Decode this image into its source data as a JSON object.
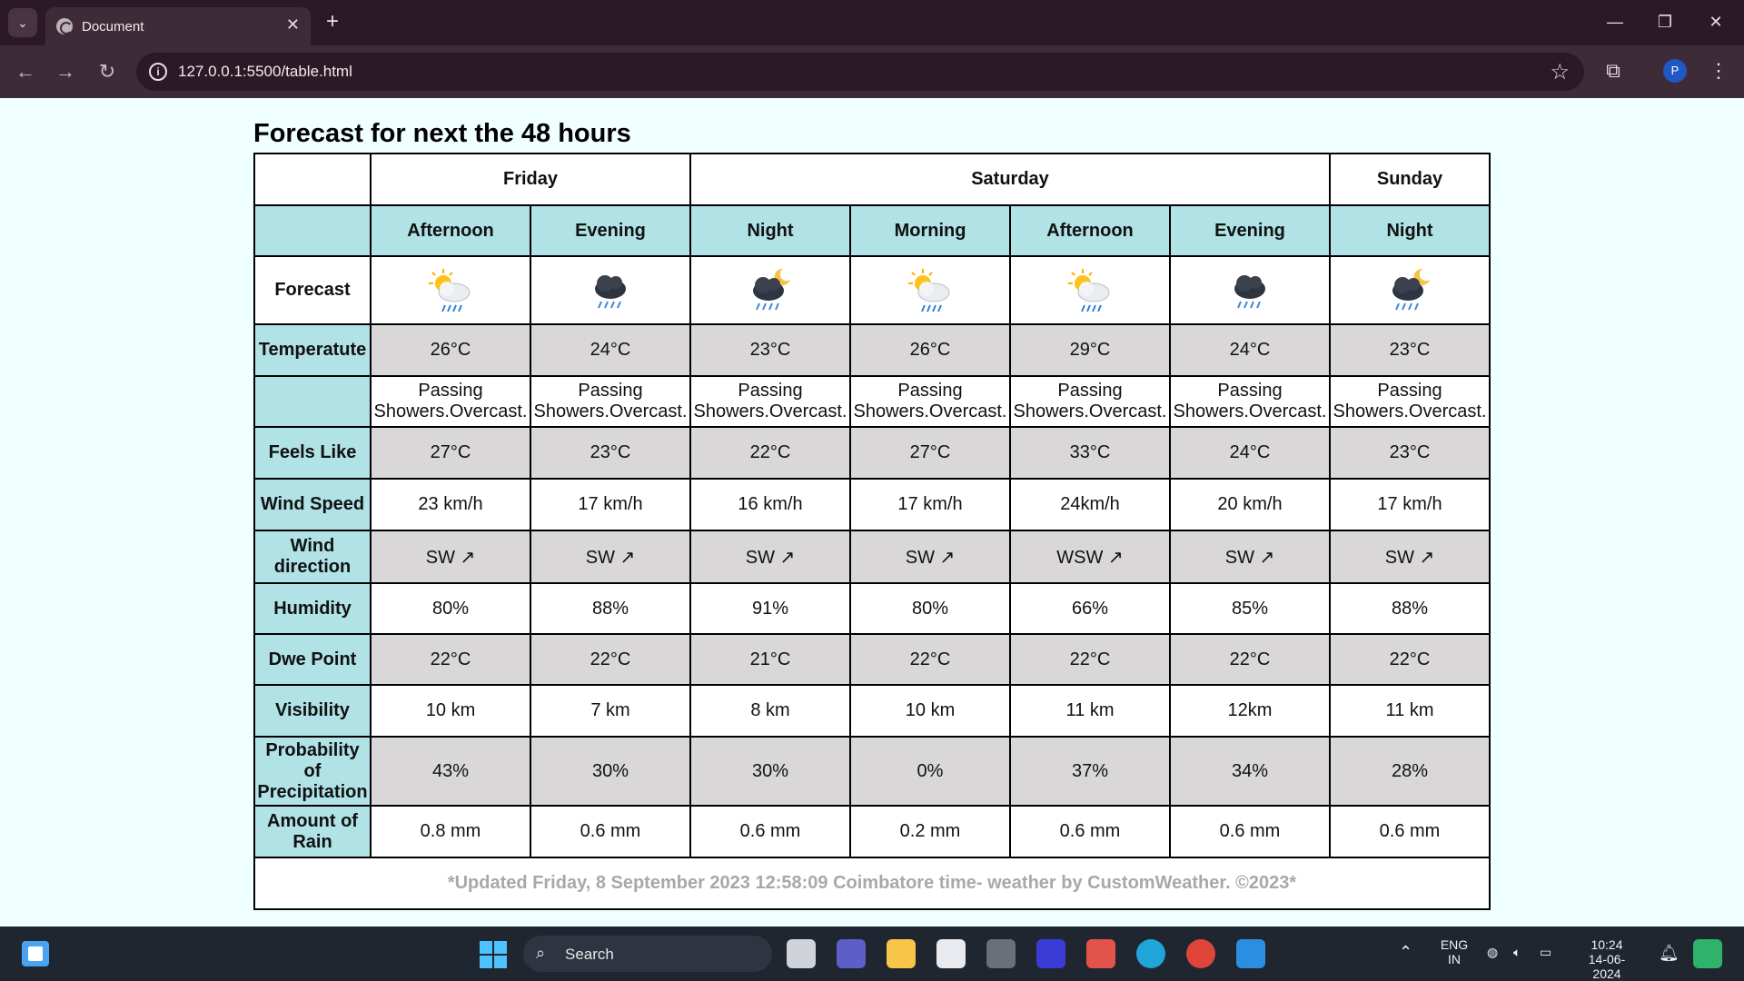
{
  "browser": {
    "tab_title": "Document",
    "url": "127.0.0.1:5500/table.html",
    "profile_initial": "P",
    "tab_close": "✕",
    "new_tab": "+",
    "minimize": "—",
    "restore": "❐",
    "close": "✕"
  },
  "page": {
    "heading": "Forecast for next the 48 hours",
    "days": [
      "Friday",
      "Saturday",
      "Sunday"
    ],
    "periods": [
      "Afternoon",
      "Evening",
      "Night",
      "Morning",
      "Afternoon",
      "Evening",
      "Night"
    ],
    "row_labels": {
      "forecast": "Forecast",
      "temperature": "Temperatute",
      "feels_like": "Feels Like",
      "wind_speed": "Wind Speed",
      "wind_direction": "Wind direction",
      "humidity": "Humidity",
      "dew_point": "Dwe Point",
      "visibility": "Visibility",
      "precip_probability": "Probability of Precipitation",
      "rain_amount": "Amount of Rain"
    },
    "forecast_icons": [
      "sun-cloud-rain-icon",
      "night-cloud-rain-icon",
      "moon-cloud-rain-icon",
      "sun-cloud-rain-icon",
      "sun-cloud-rain-icon",
      "night-cloud-rain-icon",
      "moon-cloud-rain-icon"
    ],
    "temperature": [
      "26°C",
      "24°C",
      "23°C",
      "26°C",
      "29°C",
      "24°C",
      "23°C"
    ],
    "description_line1": [
      "Passing",
      "Passing",
      "Passing",
      "Passing",
      "Passing",
      "Passing",
      "Passing"
    ],
    "description_line2": [
      "Showers.Overcast.",
      "Showers.Overcast.",
      "Showers.Overcast.",
      "Showers.Overcast.",
      "Showers.Overcast.",
      "Showers.Overcast.",
      "Showers.Overcast."
    ],
    "feels_like": [
      "27°C",
      "23°C",
      "22°C",
      "27°C",
      "33°C",
      "24°C",
      "23°C"
    ],
    "wind_speed": [
      "23 km/h",
      "17 km/h",
      "16 km/h",
      "17 km/h",
      "24km/h",
      "20 km/h",
      "17 km/h"
    ],
    "wind_direction": [
      "SW ↗",
      "SW ↗",
      "SW ↗",
      "SW ↗",
      "WSW ↗",
      "SW ↗",
      "SW ↗"
    ],
    "humidity": [
      "80%",
      "88%",
      "91%",
      "80%",
      "66%",
      "85%",
      "88%"
    ],
    "dew_point": [
      "22°C",
      "22°C",
      "21°C",
      "22°C",
      "22°C",
      "22°C",
      "22°C"
    ],
    "visibility": [
      "10 km",
      "7 km",
      "8 km",
      "10 km",
      "11 km",
      "12km",
      "11 km"
    ],
    "precip_probability": [
      "43%",
      "30%",
      "30%",
      "0%",
      "37%",
      "34%",
      "28%"
    ],
    "rain_amount": [
      "0.8 mm",
      "0.6 mm",
      "0.6 mm",
      "0.2 mm",
      "0.6 mm",
      "0.6 mm",
      "0.6 mm"
    ],
    "footer": "*Updated Friday, 8 September 2023 12:58:09 Coimbatore time- weather by CustomWeather. ©2023*"
  },
  "taskbar": {
    "search_label": "Search",
    "lang_top": "ENG",
    "lang_bottom": "IN",
    "time": "10:24",
    "date": "14-06-2024"
  },
  "colors": {
    "page_bg": "#f0ffff",
    "header_cell": "#b0e2e6",
    "grey_row": "#d9d7d7",
    "footer_text": "#a8a8a8"
  }
}
